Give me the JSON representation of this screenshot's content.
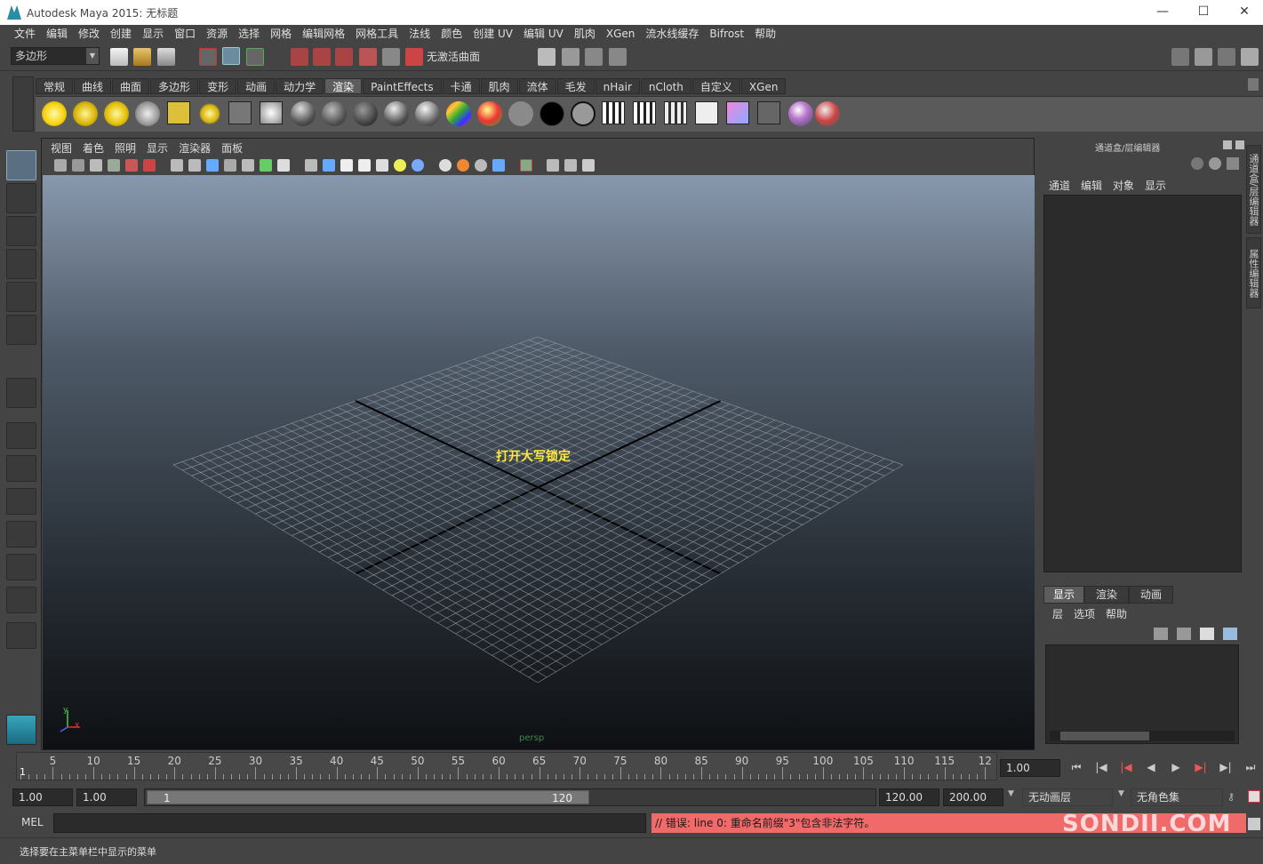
{
  "window": {
    "title": "Autodesk Maya 2015: 无标题",
    "minimize": "—",
    "maximize": "☐",
    "close": "✕"
  },
  "menubar": [
    "文件",
    "编辑",
    "修改",
    "创建",
    "显示",
    "窗口",
    "资源",
    "选择",
    "网格",
    "编辑网格",
    "网格工具",
    "法线",
    "颜色",
    "创建 UV",
    "编辑 UV",
    "肌肉",
    "XGen",
    "流水线缓存",
    "Bifrost",
    "帮助"
  ],
  "statusline": {
    "mode_menu": "多边形",
    "live_surface": "无激活曲面"
  },
  "shelf": {
    "tabs": [
      "常规",
      "曲线",
      "曲面",
      "多边形",
      "变形",
      "动画",
      "动力学",
      "渲染",
      "PaintEffects",
      "卡通",
      "肌肉",
      "流体",
      "毛发",
      "nHair",
      "nCloth",
      "自定义",
      "XGen"
    ],
    "active_tab": "渲染"
  },
  "viewport": {
    "menu": [
      "视图",
      "着色",
      "照明",
      "显示",
      "渲染器",
      "面板"
    ],
    "caps_lock_message": "打开大写锁定",
    "camera_label": "persp",
    "axis_labels": {
      "x": "x",
      "y": "y"
    }
  },
  "channel_box": {
    "title": "通道盒/层编辑器",
    "menu": [
      "通道",
      "编辑",
      "对象",
      "显示"
    ]
  },
  "layer_editor": {
    "tabs": [
      "显示",
      "渲染",
      "动画"
    ],
    "active_tab": "显示",
    "menu": [
      "层",
      "选项",
      "帮助"
    ]
  },
  "side_tabs": [
    "通道盒/层编辑器",
    "属性编辑器"
  ],
  "time_slider": {
    "ticks": [
      "5",
      "10",
      "15",
      "20",
      "25",
      "30",
      "35",
      "40",
      "45",
      "50",
      "55",
      "60",
      "65",
      "70",
      "75",
      "80",
      "85",
      "90",
      "95",
      "100",
      "105",
      "110",
      "115",
      "12"
    ],
    "start_marker": "1",
    "current_time": "1.00"
  },
  "range_slider": {
    "start_time": "1.00",
    "playback_start": "1.00",
    "range_start_label": "1",
    "range_end_label": "120",
    "playback_end": "120.00",
    "end_time": "200.00",
    "anim_layer": "无动画层",
    "character_set": "无角色集"
  },
  "command_line": {
    "language": "MEL",
    "error_message": "// 错误: line 0: 重命名前缀\"3\"包含非法字符。",
    "watermark": "SONDII.COM"
  },
  "help_line": {
    "text": "选择要在主菜单栏中显示的菜单"
  },
  "colors": {
    "error_bg": "#f06a6a",
    "caps_lock": "#ffea3b",
    "accent": "#5d5d5d"
  }
}
